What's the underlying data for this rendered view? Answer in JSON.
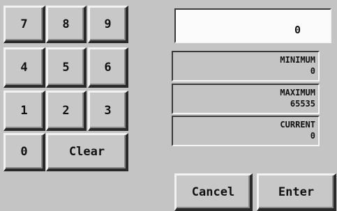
{
  "keypad": {
    "k7": "7",
    "k8": "8",
    "k9": "9",
    "k4": "4",
    "k5": "5",
    "k6": "6",
    "k1": "1",
    "k2": "2",
    "k3": "3",
    "k0": "0",
    "clear": "Clear"
  },
  "entry": {
    "value": "0"
  },
  "limits": {
    "minimum_label": "MINIMUM",
    "minimum_value": "0",
    "maximum_label": "MAXIMUM",
    "maximum_value": "65535",
    "current_label": "CURRENT",
    "current_value": "0"
  },
  "actions": {
    "cancel": "Cancel",
    "enter": "Enter"
  }
}
